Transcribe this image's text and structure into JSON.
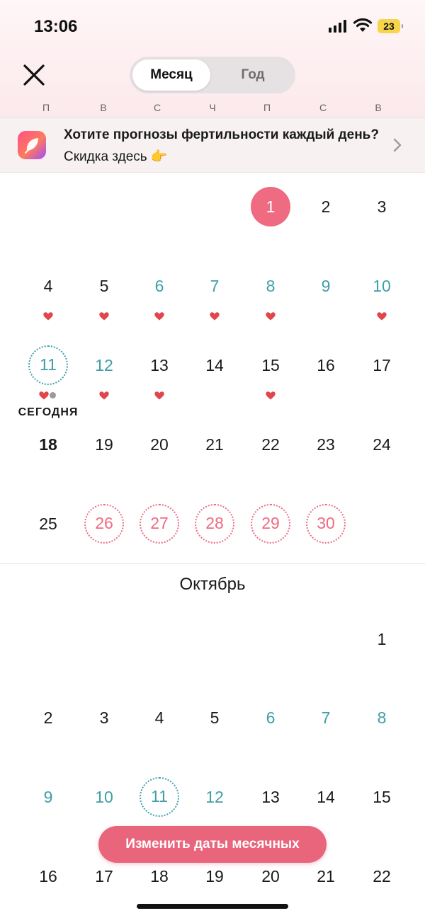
{
  "status_bar": {
    "time": "13:06",
    "battery": "23"
  },
  "header": {
    "tabs": [
      {
        "label": "Месяц",
        "active": true
      },
      {
        "label": "Год",
        "active": false
      }
    ]
  },
  "weekdays": [
    "П",
    "В",
    "С",
    "Ч",
    "П",
    "С",
    "В"
  ],
  "banner": {
    "bold_text": "Хотите прогнозы фертильности каждый день?",
    "text": " Скидка здесь 👉"
  },
  "colors": {
    "period": "#ee6b82",
    "fertile": "#3e9ea7",
    "heart": "#e0464b",
    "cta": "#e9657c"
  },
  "september": {
    "weeks": [
      [
        {
          "day": "1",
          "type": "period"
        },
        {
          "day": "2",
          "type": "normal"
        },
        {
          "day": "3",
          "type": "normal"
        }
      ],
      [
        {
          "day": "4",
          "type": "normal",
          "heart": true
        },
        {
          "day": "5",
          "type": "normal",
          "heart": true
        },
        {
          "day": "6",
          "type": "fertile",
          "heart": true
        },
        {
          "day": "7",
          "type": "fertile",
          "heart": true
        },
        {
          "day": "8",
          "type": "fertile",
          "heart": true
        },
        {
          "day": "9",
          "type": "fertile"
        },
        {
          "day": "10",
          "type": "fertile",
          "heart": true
        }
      ],
      [
        {
          "day": "11",
          "type": "today",
          "heart": true,
          "dot": true
        },
        {
          "day": "12",
          "type": "fertile",
          "heart": true
        },
        {
          "day": "13",
          "type": "normal",
          "heart": true
        },
        {
          "day": "14",
          "type": "normal"
        },
        {
          "day": "15",
          "type": "normal",
          "heart": true
        },
        {
          "day": "16",
          "type": "normal"
        },
        {
          "day": "17",
          "type": "normal"
        }
      ],
      [
        {
          "day": "18",
          "type": "bold"
        },
        {
          "day": "19",
          "type": "normal"
        },
        {
          "day": "20",
          "type": "normal"
        },
        {
          "day": "21",
          "type": "normal"
        },
        {
          "day": "22",
          "type": "normal"
        },
        {
          "day": "23",
          "type": "normal"
        },
        {
          "day": "24",
          "type": "normal"
        }
      ],
      [
        {
          "day": "25",
          "type": "normal"
        },
        {
          "day": "26",
          "type": "predicted"
        },
        {
          "day": "27",
          "type": "predicted"
        },
        {
          "day": "28",
          "type": "predicted"
        },
        {
          "day": "29",
          "type": "predicted"
        },
        {
          "day": "30",
          "type": "predicted"
        }
      ]
    ],
    "today_label": "СЕГОДНЯ"
  },
  "october": {
    "name": "Октябрь",
    "weeks": [
      [
        {
          "day": "1",
          "type": "normal"
        }
      ],
      [
        {
          "day": "2",
          "type": "normal"
        },
        {
          "day": "3",
          "type": "normal"
        },
        {
          "day": "4",
          "type": "normal"
        },
        {
          "day": "5",
          "type": "normal"
        },
        {
          "day": "6",
          "type": "fertile"
        },
        {
          "day": "7",
          "type": "fertile"
        },
        {
          "day": "8",
          "type": "fertile"
        }
      ],
      [
        {
          "day": "9",
          "type": "fertile"
        },
        {
          "day": "10",
          "type": "fertile"
        },
        {
          "day": "11",
          "type": "ovulation"
        },
        {
          "day": "12",
          "type": "fertile"
        },
        {
          "day": "13",
          "type": "normal"
        },
        {
          "day": "14",
          "type": "normal"
        },
        {
          "day": "15",
          "type": "normal"
        }
      ],
      [
        {
          "day": "16",
          "type": "normal"
        },
        {
          "day": "17",
          "type": "normal"
        },
        {
          "day": "18",
          "type": "normal"
        },
        {
          "day": "19",
          "type": "normal"
        },
        {
          "day": "20",
          "type": "normal"
        },
        {
          "day": "21",
          "type": "normal"
        },
        {
          "day": "22",
          "type": "normal"
        }
      ]
    ]
  },
  "cta_label": "Изменить даты месячных"
}
